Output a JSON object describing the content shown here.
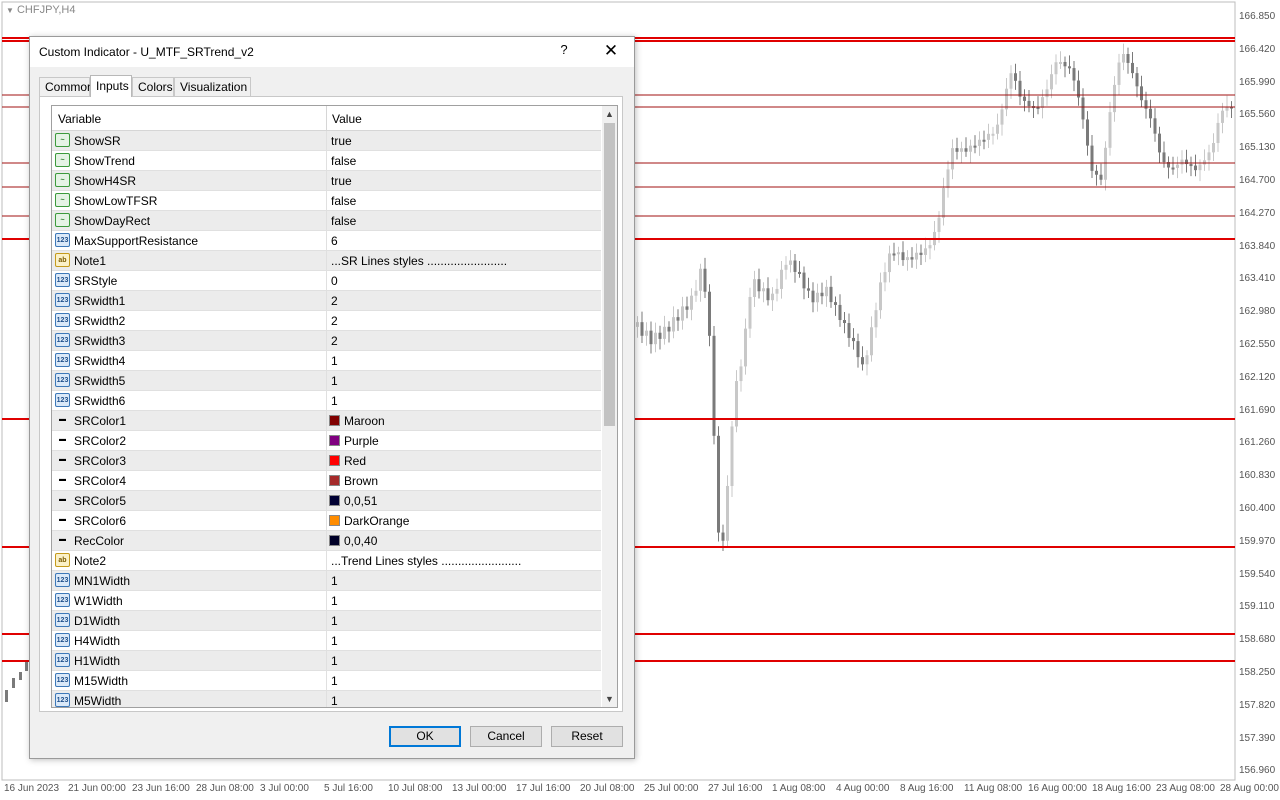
{
  "chart": {
    "symbol": "CHFJPY,H4",
    "price_axis": [
      "166.850",
      "166.420",
      "165.990",
      "165.560",
      "165.130",
      "164.700",
      "164.270",
      "163.840",
      "163.410",
      "162.980",
      "162.550",
      "162.120",
      "161.690",
      "161.260",
      "160.830",
      "160.400",
      "159.970",
      "159.540",
      "159.110",
      "158.680",
      "158.250",
      "157.820",
      "157.390",
      "156.960"
    ],
    "time_axis": [
      "16 Jun 2023",
      "21 Jun 00:00",
      "23 Jun 16:00",
      "28 Jun 08:00",
      "3 Jul 00:00",
      "5 Jul 16:00",
      "10 Jul 08:00",
      "13 Jul 00:00",
      "17 Jul 16:00",
      "20 Jul 08:00",
      "25 Jul 00:00",
      "27 Jul 16:00",
      "1 Aug 08:00",
      "4 Aug 00:00",
      "8 Aug 16:00",
      "11 Aug 08:00",
      "16 Aug 00:00",
      "18 Aug 16:00",
      "23 Aug 08:00",
      "28 Aug 00:00"
    ],
    "colors": {
      "sr_bold": "#e00000",
      "sr_thin": "#a01010",
      "candle_dark": "#7a7a7a",
      "candle_light": "#c8c8c8"
    }
  },
  "dialog": {
    "title": "Custom Indicator - U_MTF_SRTrend_v2",
    "help_label": "?",
    "close_label": "✕",
    "tabs": [
      "Common",
      "Inputs",
      "Colors",
      "Visualization"
    ],
    "active_tab": "Inputs",
    "columns": {
      "variable": "Variable",
      "value": "Value"
    },
    "rows": [
      {
        "name": "ShowSR",
        "value": "true",
        "kind": "bool"
      },
      {
        "name": "ShowTrend",
        "value": "false",
        "kind": "bool"
      },
      {
        "name": "ShowH4SR",
        "value": "true",
        "kind": "bool"
      },
      {
        "name": "ShowLowTFSR",
        "value": "false",
        "kind": "bool"
      },
      {
        "name": "ShowDayRect",
        "value": "false",
        "kind": "bool"
      },
      {
        "name": "MaxSupportResistance",
        "value": "6",
        "kind": "int"
      },
      {
        "name": "Note1",
        "value": "...SR Lines styles ........................",
        "kind": "str"
      },
      {
        "name": "SRStyle",
        "value": "0",
        "kind": "int"
      },
      {
        "name": "SRwidth1",
        "value": "2",
        "kind": "int"
      },
      {
        "name": "SRwidth2",
        "value": "2",
        "kind": "int"
      },
      {
        "name": "SRwidth3",
        "value": "2",
        "kind": "int"
      },
      {
        "name": "SRwidth4",
        "value": "1",
        "kind": "int"
      },
      {
        "name": "SRwidth5",
        "value": "1",
        "kind": "int"
      },
      {
        "name": "SRwidth6",
        "value": "1",
        "kind": "int"
      },
      {
        "name": "SRColor1",
        "value": "Maroon",
        "kind": "color",
        "swatch": "#800000"
      },
      {
        "name": "SRColor2",
        "value": "Purple",
        "kind": "color",
        "swatch": "#800080"
      },
      {
        "name": "SRColor3",
        "value": "Red",
        "kind": "color",
        "swatch": "#ff0000"
      },
      {
        "name": "SRColor4",
        "value": "Brown",
        "kind": "color",
        "swatch": "#a52a2a"
      },
      {
        "name": "SRColor5",
        "value": "0,0,51",
        "kind": "color",
        "swatch": "#000033"
      },
      {
        "name": "SRColor6",
        "value": "DarkOrange",
        "kind": "color",
        "swatch": "#ff8c00"
      },
      {
        "name": "RecColor",
        "value": "0,0,40",
        "kind": "color",
        "swatch": "#000028"
      },
      {
        "name": "Note2",
        "value": "...Trend Lines styles ........................",
        "kind": "str"
      },
      {
        "name": "MN1Width",
        "value": "1",
        "kind": "int"
      },
      {
        "name": "W1Width",
        "value": "1",
        "kind": "int"
      },
      {
        "name": "D1Width",
        "value": "1",
        "kind": "int"
      },
      {
        "name": "H4Width",
        "value": "1",
        "kind": "int"
      },
      {
        "name": "H1Width",
        "value": "1",
        "kind": "int"
      },
      {
        "name": "M15Width",
        "value": "1",
        "kind": "int"
      },
      {
        "name": "M5Width",
        "value": "1",
        "kind": "int"
      }
    ],
    "icon_labels": {
      "bool": "~",
      "int": "123",
      "str": "ab",
      "color": "▬"
    },
    "scroll_up": "▲",
    "scroll_down": "▼",
    "buttons": {
      "ok": "OK",
      "cancel": "Cancel",
      "reset": "Reset"
    }
  }
}
